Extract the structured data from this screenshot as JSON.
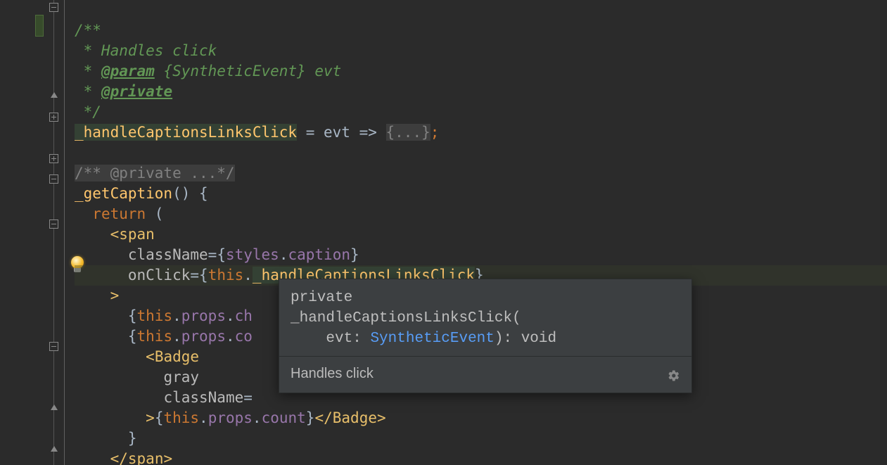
{
  "doc": {
    "open": "/**",
    "l1": " * Handles click",
    "l2a": " * ",
    "l2tag": "@param",
    "l2b": " {SyntheticEvent} evt",
    "l3a": " * ",
    "l3tag": "@private",
    "close": " */"
  },
  "decl": {
    "name": "_handleCaptionsLinksClick",
    "rest": " = evt => ",
    "fold": "{...}",
    "semi": ";"
  },
  "fold_private": "/** @private ...*/",
  "fn": {
    "name": "_getCaption",
    "parens": "() {",
    "ret": "return",
    "retopen": " (",
    "tag_open": "<",
    "tag_span": "span",
    "attr_class": "className",
    "eq": "=",
    "lcb": "{",
    "rcb": "}",
    "styles": "styles",
    "dot": ".",
    "caption": "caption",
    "attr_onclick": "onClick",
    "this": "this",
    "method": "_handleCaptionsLinksClick",
    "gt": ">",
    "props": "props",
    "ch": "ch",
    "co": "co",
    "badge": "Badge",
    "gray": "gray",
    "count": "count",
    "lt": "<",
    "slash": "/"
  },
  "tooltip": {
    "private": "private",
    "name": "_handleCaptionsLinksClick",
    "openp": "(",
    "param_indent": "    ",
    "pname": "evt",
    "colon": ": ",
    "ptype": "SyntheticEvent",
    "closep": "): ",
    "rtype": "void",
    "desc": "Handles click"
  }
}
